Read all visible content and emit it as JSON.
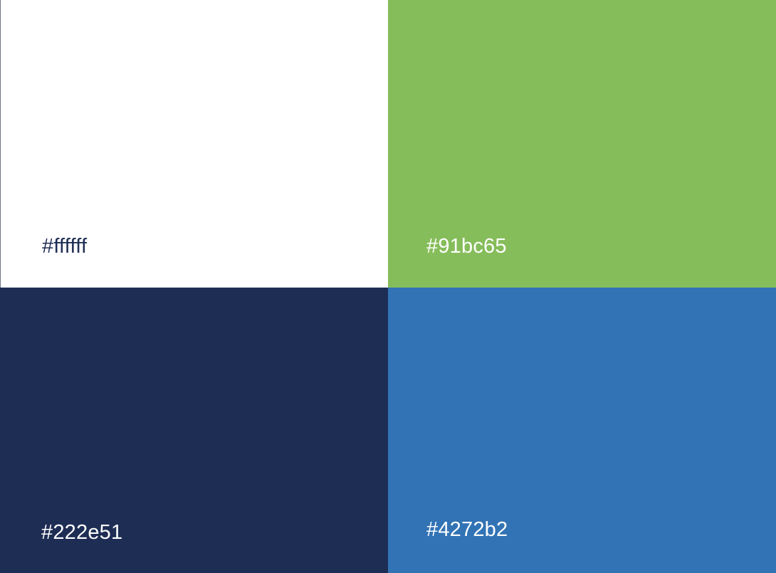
{
  "swatches": [
    {
      "label": "#ffffff",
      "fill": "#ffffff",
      "text_color": "#1e2d54"
    },
    {
      "label": "#91bc65",
      "fill": "#86bd5b",
      "text_color": "#ffffff"
    },
    {
      "label": "#222e51",
      "fill": "#1e2d54",
      "text_color": "#ffffff"
    },
    {
      "label": "#4272b2",
      "fill": "#3273b5",
      "text_color": "#ffffff"
    }
  ]
}
